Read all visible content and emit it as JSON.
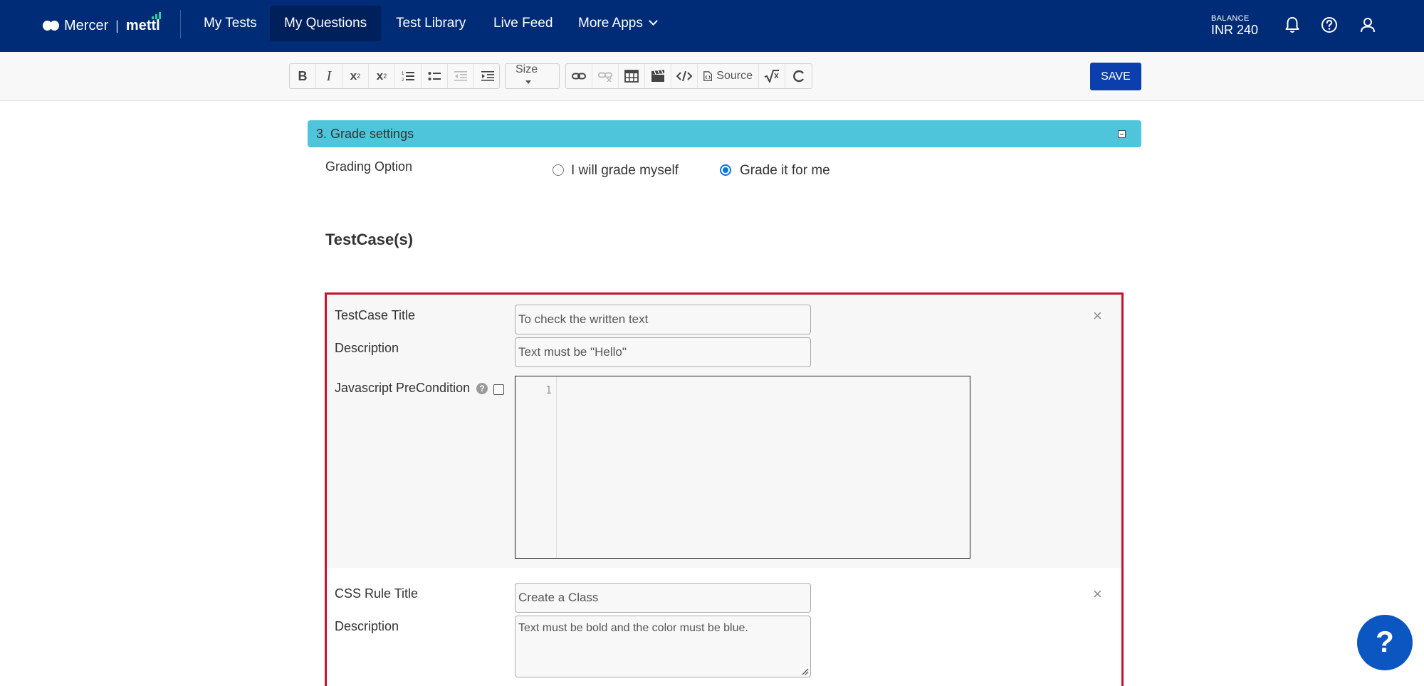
{
  "nav": {
    "brand_left": "Mercer",
    "brand_sep": "|",
    "brand_right": "mettl",
    "items": [
      {
        "label": "My Tests"
      },
      {
        "label": "My Questions"
      },
      {
        "label": "Test Library"
      },
      {
        "label": "Live Feed"
      },
      {
        "label": "More Apps"
      }
    ],
    "active": "My Questions",
    "balance_label": "BALANCE",
    "balance_value": "INR 240",
    "icons": [
      "bell-icon",
      "help-circle-icon",
      "user-icon"
    ]
  },
  "toolbar": {
    "buttons": [
      "bold",
      "italic",
      "superscript",
      "subscript",
      "numbered-list",
      "bulleted-list",
      "outdent",
      "indent",
      "size",
      "link",
      "unlink",
      "table",
      "video",
      "code",
      "source",
      "math",
      "refresh"
    ],
    "size_label": "Size",
    "source_label": "Source",
    "save_label": "SAVE"
  },
  "grade_settings": {
    "header": "3. Grade settings",
    "grading_label": "Grading Option",
    "options": [
      {
        "label": "I will grade myself",
        "selected": false
      },
      {
        "label": "Grade it for me",
        "selected": true
      }
    ]
  },
  "testcases": {
    "title": "TestCase(s)",
    "testcase": {
      "title_label": "TestCase Title",
      "title_value": "To check the written text",
      "description_label": "Description",
      "description_value": "Text must be \"Hello\"",
      "precondition_label": "Javascript PreCondition",
      "precondition_help": "?",
      "line_number": "1"
    },
    "css_rule": {
      "title_label": "CSS Rule Title",
      "title_value": "Create a Class",
      "description_label": "Description",
      "description_value": "Text must be bold and the color must be blue."
    },
    "close_symbol": "×"
  },
  "help_fab": "?",
  "colors": {
    "nav_bg": "#002c77",
    "panel_header": "#4ec5db",
    "save_button": "#0b3fae",
    "testcase_border": "#c8102e",
    "radio_checked": "#0a73e8"
  }
}
